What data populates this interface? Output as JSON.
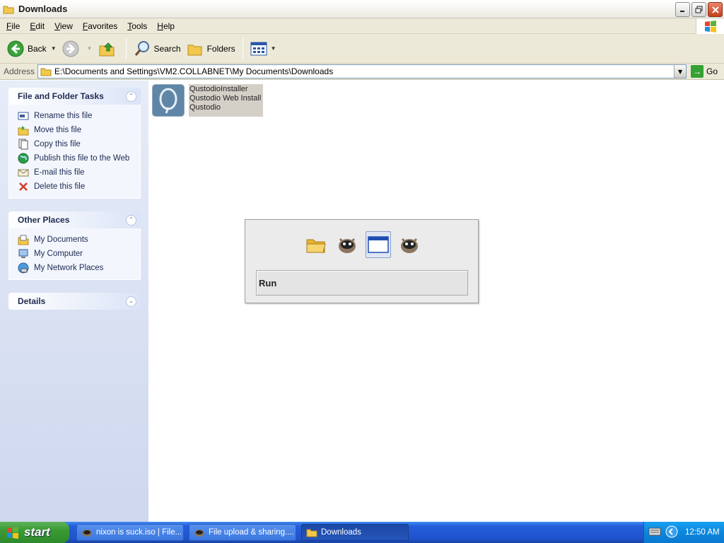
{
  "window": {
    "title": "Downloads"
  },
  "menu": [
    "File",
    "Edit",
    "View",
    "Favorites",
    "Tools",
    "Help"
  ],
  "toolbar": {
    "back": "Back",
    "search": "Search",
    "folders": "Folders"
  },
  "address": {
    "label": "Address",
    "value": "E:\\Documents and Settings\\VM2.COLLABNET\\My Documents\\Downloads",
    "go": "Go"
  },
  "sidebar": {
    "file_tasks": {
      "title": "File and Folder Tasks",
      "items": [
        "Rename this file",
        "Move this file",
        "Copy this file",
        "Publish this file to the Web",
        "E-mail this file",
        "Delete this file"
      ]
    },
    "other_places": {
      "title": "Other Places",
      "items": [
        "My Documents",
        "My Computer",
        "My Network Places"
      ]
    },
    "details": {
      "title": "Details"
    }
  },
  "file": {
    "lines": [
      "QustodioInstaller",
      "Qustodio Web Install",
      "Qustodio"
    ]
  },
  "run_popup": {
    "text": "Run"
  },
  "taskbar": {
    "start": "start",
    "buttons": [
      "nixon is suck.iso | File...",
      "File upload & sharing....",
      "Downloads"
    ],
    "clock": "12:50 AM"
  }
}
